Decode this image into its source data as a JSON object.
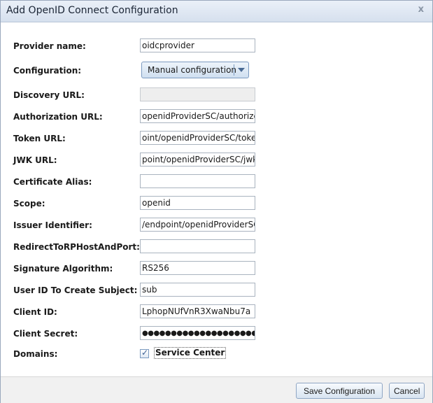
{
  "dialog": {
    "title": "Add OpenID Connect Configuration",
    "close_glyph": "x"
  },
  "form": {
    "provider_name": {
      "label": "Provider name:",
      "value": "oidcprovider"
    },
    "configuration": {
      "label": "Configuration:",
      "value": "Manual configuration"
    },
    "discovery_url": {
      "label": "Discovery URL:",
      "value": ""
    },
    "authorization_url": {
      "label": "Authorization URL:",
      "value": "openidProviderSC/authorize"
    },
    "token_url": {
      "label": "Token URL:",
      "value": "oint/openidProviderSC/token"
    },
    "jwk_url": {
      "label": "JWK URL:",
      "value": "point/openidProviderSC/jwk"
    },
    "certificate_alias": {
      "label": "Certificate Alias:",
      "value": ""
    },
    "scope": {
      "label": "Scope:",
      "value": "openid"
    },
    "issuer_identifier": {
      "label": "Issuer Identifier:",
      "value": "/endpoint/openidProviderSC"
    },
    "redirect_host_port": {
      "label": "RedirectToRPHostAndPort:",
      "value": ""
    },
    "signature_algorithm": {
      "label": "Signature Algorithm:",
      "value": "RS256"
    },
    "user_id_subject": {
      "label": "User ID To Create Subject:",
      "value": "sub"
    },
    "client_id": {
      "label": "Client ID:",
      "value": "LphopNUfVnR3XwaNbu7a"
    },
    "client_secret": {
      "label": "Client Secret:",
      "value": "●●●●●●●●●●●●●●●●●●●●"
    },
    "domains": {
      "label": "Domains:",
      "option": "Service Center",
      "checked": true
    }
  },
  "footer": {
    "save_label": "Save Configuration",
    "cancel_label": "Cancel"
  }
}
